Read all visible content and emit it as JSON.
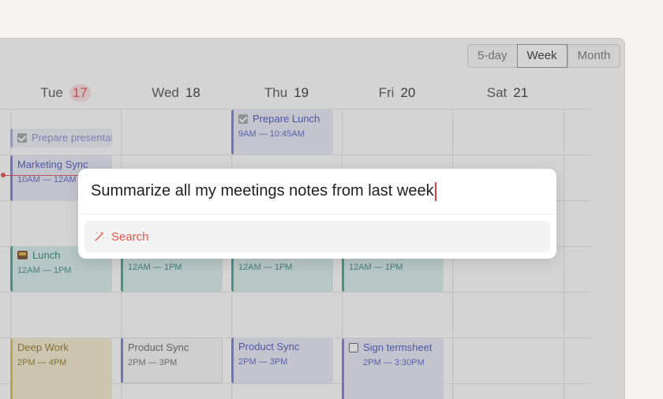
{
  "view_switch": {
    "five_day": "5-day",
    "week": "Week",
    "month": "Month",
    "selected": "Week"
  },
  "days": [
    {
      "name": "Tue",
      "num": "17",
      "today": true
    },
    {
      "name": "Wed",
      "num": "18"
    },
    {
      "name": "Thu",
      "num": "19"
    },
    {
      "name": "Fri",
      "num": "20"
    },
    {
      "name": "Sat",
      "num": "21"
    }
  ],
  "events": {
    "tue_prepare": {
      "title": "Prepare presentat"
    },
    "tue_marketing": {
      "title": "Marketing Sync",
      "time": "10AM — 12AM"
    },
    "tue_lunch": {
      "title": "Lunch",
      "time": "12AM — 1PM"
    },
    "tue_deep": {
      "title": "Deep Work",
      "time": "2PM — 4PM"
    },
    "wed_lunch": {
      "time": "12AM — 1PM"
    },
    "wed_product": {
      "title": "Product Sync",
      "time": "2PM — 3PM"
    },
    "thu_prepare": {
      "title": "Prepare Lunch",
      "time": "9AM — 10:45AM"
    },
    "thu_lunch": {
      "time": "12AM — 1PM"
    },
    "thu_product": {
      "title": "Product Sync",
      "time": "2PM — 3PM"
    },
    "fri_lunch": {
      "time": "12AM — 1PM"
    },
    "fri_sign": {
      "title": "Sign termsheet",
      "time": "2PM — 3:30PM"
    }
  },
  "palette": {
    "query": "Summarize all my meetings notes from last week",
    "option_label": "Search"
  },
  "colors": {
    "accent": "#e03e3e",
    "purple_event": "#6b74d6",
    "teal_event": "#2f9e8e",
    "yellow_event": "#d6b548"
  }
}
